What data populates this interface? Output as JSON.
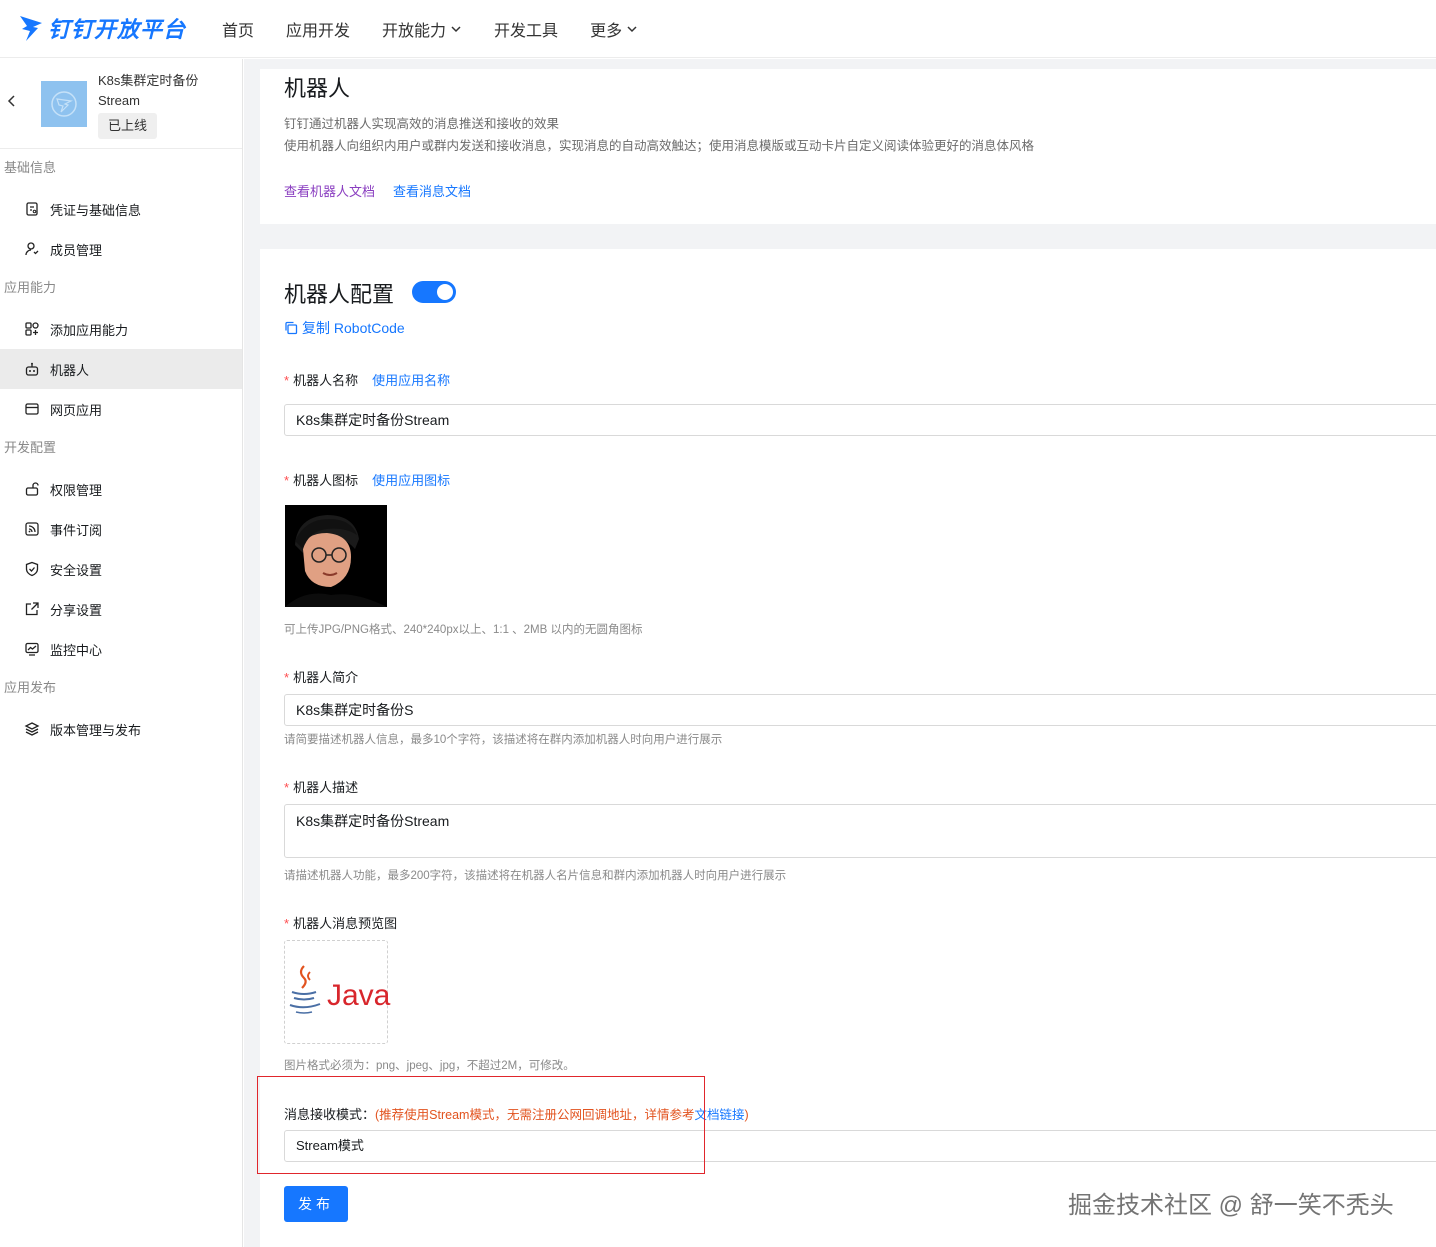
{
  "header": {
    "brand": "钉钉开放平台",
    "nav": [
      {
        "label": "首页",
        "dropdown": false
      },
      {
        "label": "应用开发",
        "dropdown": false
      },
      {
        "label": "开放能力",
        "dropdown": true
      },
      {
        "label": "开发工具",
        "dropdown": false
      },
      {
        "label": "更多",
        "dropdown": true
      }
    ]
  },
  "sidebar": {
    "app_name": "K8s集群定时备份",
    "app_sub": "Stream",
    "status": "已上线",
    "groups": [
      {
        "title": "基础信息",
        "items": [
          "凭证与基础信息",
          "成员管理"
        ]
      },
      {
        "title": "应用能力",
        "items": [
          "添加应用能力",
          "机器人",
          "网页应用"
        ]
      },
      {
        "title": "开发配置",
        "items": [
          "权限管理",
          "事件订阅",
          "安全设置",
          "分享设置",
          "监控中心"
        ]
      },
      {
        "title": "应用发布",
        "items": [
          "版本管理与发布"
        ]
      }
    ],
    "active_item": "机器人"
  },
  "intro": {
    "title": "机器人",
    "desc1": "钉钉通过机器人实现高效的消息推送和接收的效果",
    "desc2": "使用机器人向组织内用户或群内发送和接收消息，实现消息的自动高效触达；使用消息模版或互动卡片自定义阅读体验更好的消息体风格",
    "link_robot_doc": "查看机器人文档",
    "link_msg_doc": "查看消息文档"
  },
  "config": {
    "title": "机器人配置",
    "enabled": true,
    "copy_label": "复制 RobotCode",
    "name_label": "机器人名称",
    "name_action": "使用应用名称",
    "name_value": "K8s集群定时备份Stream",
    "icon_label": "机器人图标",
    "icon_action": "使用应用图标",
    "icon_hint": "可上传JPG/PNG格式、240*240px以上、1:1 、2MB 以内的无圆角图标",
    "intro_label": "机器人简介",
    "intro_value": "K8s集群定时备份S",
    "intro_hint": "请简要描述机器人信息，最多10个字符，该描述将在群内添加机器人时向用户进行展示",
    "desc_label": "机器人描述",
    "desc_value": "K8s集群定时备份Stream",
    "desc_hint": "请描述机器人功能，最多200字符，该描述将在机器人名片信息和群内添加机器人时向用户进行展示",
    "preview_label": "机器人消息预览图",
    "preview_logo_text": "Java",
    "preview_hint": "图片格式必须为：png、jpeg、jpg，不超过2M，可修改。",
    "mode_label": "消息接收模式：",
    "mode_warn_open": "(推荐使用Stream模式，无需注册公网回调地址，详情参考",
    "mode_link": "文档链接",
    "mode_warn_close": ")",
    "mode_value": "Stream模式",
    "publish_label": "发布"
  },
  "watermark": "掘金技术社区 @ 舒一笑不秃头",
  "colors": {
    "accent": "#1677ff",
    "required": "#ff4d4f",
    "warning": "#e2531f",
    "highlight_box": "#e0262c"
  }
}
